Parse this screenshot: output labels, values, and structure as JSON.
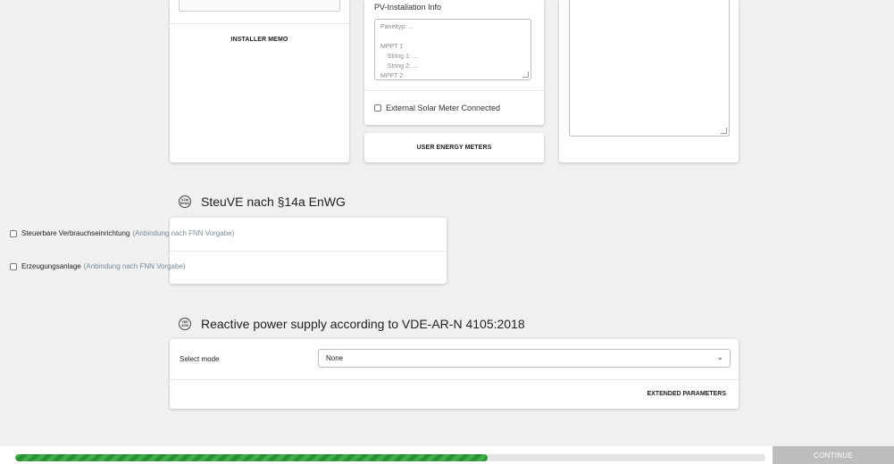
{
  "installer": {
    "memo_label": "INSTALLER MEMO"
  },
  "pv": {
    "label": "PV-Installation Info",
    "placeholder_lines": [
      "Paneltyp: ...",
      "",
      "MPPT 1",
      "    String 1: ...",
      "    String 2: ...",
      "MPPT 2"
    ],
    "external_meter_label": "External Solar Meter Connected"
  },
  "user_meters": {
    "label": "USER ENERGY METERS"
  },
  "steuve": {
    "icon_text": "§14a EnWG",
    "title": "SteuVE nach §14a EnWG",
    "options": [
      {
        "label": "Steuerbare Verbrauchseinrichtung",
        "hint": "(Anbindung nach FNN Vorgabe)"
      },
      {
        "label": "Erzeugungsanlage",
        "hint": "(Anbindung nach FNN Vorgabe)"
      }
    ]
  },
  "reactive": {
    "icon_text": "VDE 4105",
    "title": "Reactive power supply according to VDE-AR-N 4105:2018",
    "select_label": "Select mode",
    "select_value": "None",
    "extended_label": "EXTENDED PARAMETERS"
  },
  "footer": {
    "progress_fraction": 0.63,
    "progress_color": "#3fae49",
    "continue_label": "CONTINUE"
  }
}
